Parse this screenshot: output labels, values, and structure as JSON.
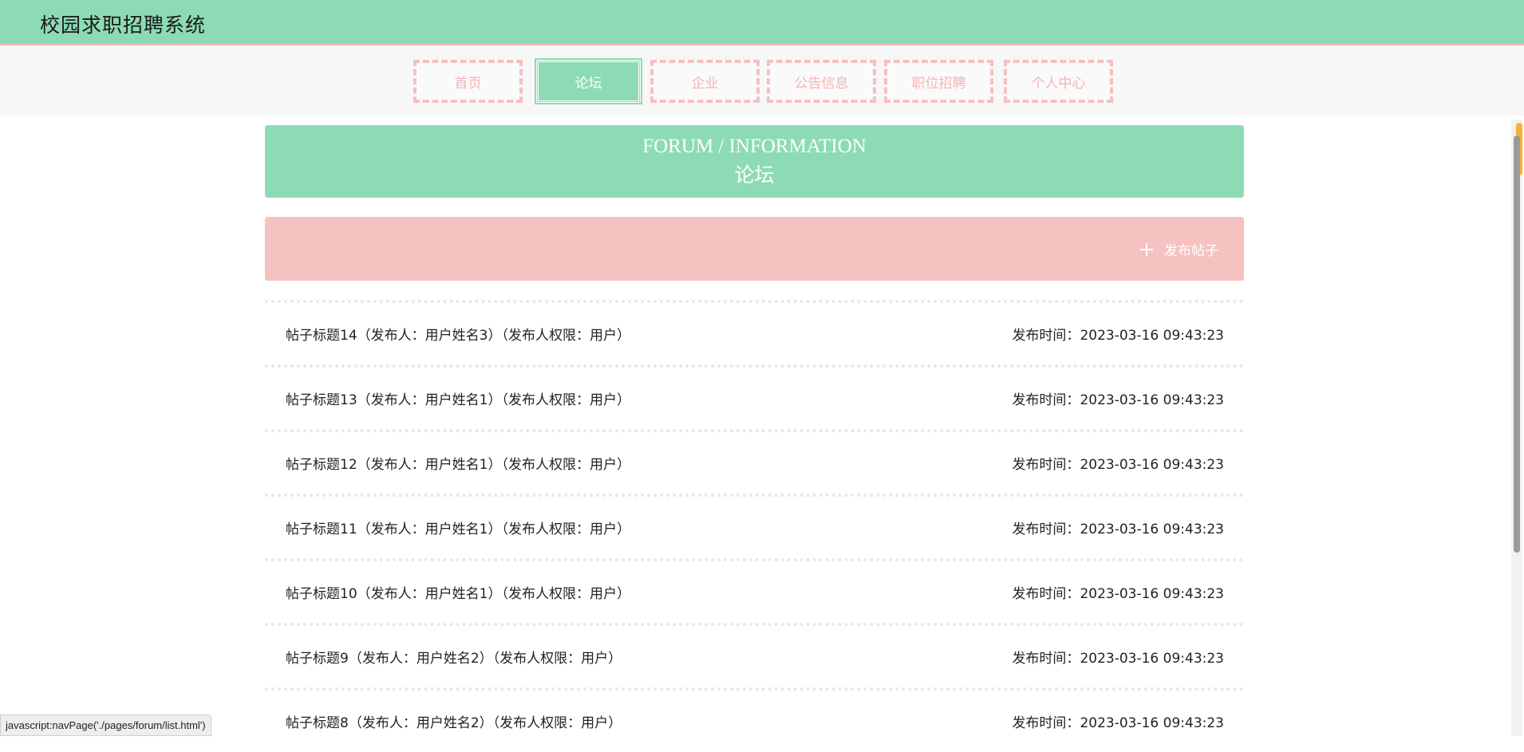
{
  "header": {
    "title": "校园求职招聘系统"
  },
  "nav": {
    "items": [
      {
        "label": "首页"
      },
      {
        "label": "论坛"
      },
      {
        "label": "企业"
      },
      {
        "label": "公告信息"
      },
      {
        "label": "职位招聘"
      },
      {
        "label": "个人中心"
      }
    ],
    "active_index": 1
  },
  "banner": {
    "en": "FORUM / INFORMATION",
    "cn": "论坛"
  },
  "actions": {
    "add_post_label": "发布帖子",
    "add_icon": "plus-icon"
  },
  "posts": [
    {
      "text": "帖子标题14（发布人：用户姓名3）（发布人权限：用户）",
      "time_label": "发布时间：",
      "time": "2023-03-16 09:43:23"
    },
    {
      "text": "帖子标题13（发布人：用户姓名1）（发布人权限：用户）",
      "time_label": "发布时间：",
      "time": "2023-03-16 09:43:23"
    },
    {
      "text": "帖子标题12（发布人：用户姓名1）（发布人权限：用户）",
      "time_label": "发布时间：",
      "time": "2023-03-16 09:43:23"
    },
    {
      "text": "帖子标题11（发布人：用户姓名1）（发布人权限：用户）",
      "time_label": "发布时间：",
      "time": "2023-03-16 09:43:23"
    },
    {
      "text": "帖子标题10（发布人：用户姓名1）（发布人权限：用户）",
      "time_label": "发布时间：",
      "time": "2023-03-16 09:43:23"
    },
    {
      "text": "帖子标题9（发布人：用户姓名2）（发布人权限：用户）",
      "time_label": "发布时间：",
      "time": "2023-03-16 09:43:23"
    },
    {
      "text": "帖子标题8（发布人：用户姓名2）（发布人权限：用户）",
      "time_label": "发布时间：",
      "time": "2023-03-16 09:43:23"
    }
  ],
  "status_bar": {
    "url": "javascript:navPage('./pages/forum/list.html')"
  },
  "colors": {
    "primary": "#8cdbb5",
    "accent": "#f6c1c1",
    "nav_text": "#f5b4b4"
  }
}
